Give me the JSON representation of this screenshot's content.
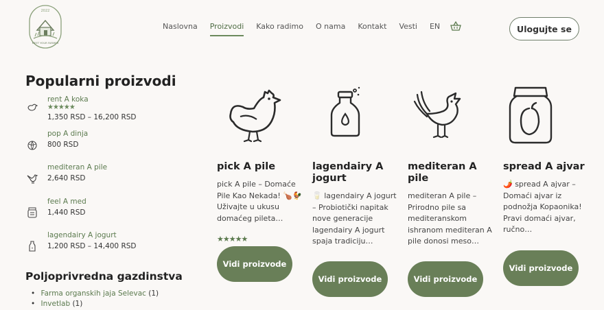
{
  "logo": {
    "year": "2022",
    "text": "MEET YOUR FARMER"
  },
  "nav": {
    "items": [
      "Naslovna",
      "Proizvodi",
      "Kako radimo",
      "O nama",
      "Kontakt",
      "Vesti",
      "EN"
    ],
    "active": "Proizvodi",
    "cart_icon": "basket-icon"
  },
  "login_label": "Ulogujte se",
  "sidebar": {
    "title": "Popularni proizvodi",
    "items": [
      {
        "name": "rent A koka",
        "stars": "★★★★★",
        "price": "1,350 RSD – 16,200 RSD",
        "icon": "chicken-icon"
      },
      {
        "name": "pop A dinja",
        "price": "800 RSD",
        "icon": "melon-icon"
      },
      {
        "name": "mediteran A pile",
        "price": "2,640 RSD",
        "icon": "hen-icon"
      },
      {
        "name": "feel A med",
        "price": "1,440 RSD",
        "icon": "honey-jar-icon"
      },
      {
        "name": "lagendairy A jogurt",
        "price": "1,200 RSD – 14,400 RSD",
        "icon": "bottle-icon"
      }
    ],
    "farms_title": "Poljoprivredna gazdinstva",
    "farms": [
      {
        "name": "Farma organskih jaja Selevac",
        "count": "(1)"
      },
      {
        "name": "Invetlab",
        "count": "(1)"
      }
    ]
  },
  "products": [
    {
      "title": "pick A pile",
      "desc": "pick A pile – Domaće Pile Kao Nekada! 🍗🐓 Uživajte u ukusu domaćeg pileta…",
      "stars": "★★★★★",
      "button": "Vidi proizvode",
      "icon": "chicken-icon"
    },
    {
      "title": "lagendairy A jogurt",
      "desc": "🥛 lagendairy A jogurt – Probiotički napitak nove generacije lagendairy A jogurt spaja tradiciju…",
      "button": "Vidi proizvode",
      "icon": "milk-bottle-icon"
    },
    {
      "title": "mediteran A pile",
      "desc": "mediteran A pile – Prirodno pile sa mediteranskom ishranom mediteran A pile donosi meso…",
      "button": "Vidi proizvode",
      "icon": "rooster-icon"
    },
    {
      "title": "spread A ajvar",
      "desc": "🌶️ spread A ajvar – Domaći ajvar iz podnožja Kopaonika! Pravi domaći ajvar, ručno…",
      "button": "Vidi proizvode",
      "icon": "jar-icon"
    }
  ],
  "colors": {
    "accent": "#697f58",
    "background": "#faf8f6",
    "link": "#5b7a4e"
  }
}
